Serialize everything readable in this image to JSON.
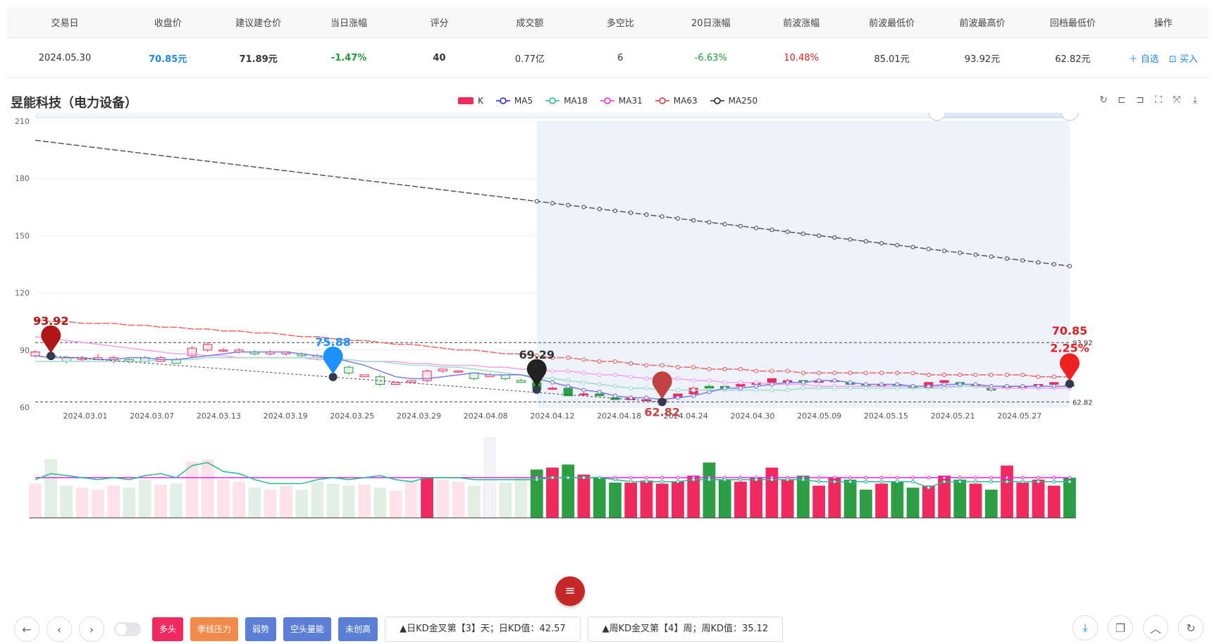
{
  "table": {
    "headers": [
      "交易日",
      "收盘价",
      "建议建仓价",
      "当日涨幅",
      "评分",
      "成交额",
      "多空比",
      "20日涨幅",
      "前波涨幅",
      "前波最低价",
      "前波最高价",
      "回档最低价",
      "操作"
    ],
    "row": {
      "date": "2024.05.30",
      "close": "70.85元",
      "suggest": "71.89元",
      "day_chg": "-1.47%",
      "score": "40",
      "amount": "0.77亿",
      "ratio": "6",
      "chg20": "-6.63%",
      "prev_wave": "10.48%",
      "prev_low": "85.01元",
      "prev_high": "93.92元",
      "pullback_low": "62.82元",
      "op_add": "＋ 自选",
      "op_buy": "买入"
    }
  },
  "chart_title": "昱能科技（电力设备）",
  "legend": [
    {
      "name": "K",
      "color": "#f0295f"
    },
    {
      "name": "MA5",
      "color": "#2222dd"
    },
    {
      "name": "MA18",
      "color": "#1fbf8f"
    },
    {
      "name": "MA31",
      "color": "#ee22ee"
    },
    {
      "name": "MA63",
      "color": "#e03030"
    },
    {
      "name": "MA250",
      "color": "#222222"
    }
  ],
  "chart_data": {
    "type": "candlestick",
    "ylim": [
      60,
      210
    ],
    "yticks": [
      "210",
      "180",
      "150",
      "120",
      "90",
      "60"
    ],
    "xticks": [
      "2024.03.01",
      "2024.03.07",
      "2024.03.13",
      "2024.03.19",
      "2024.03.25",
      "2024.03.29",
      "2024.04.08",
      "2024.04.12",
      "2024.04.18",
      "2024.04.24",
      "2024.04.30",
      "2024.05.09",
      "2024.05.15",
      "2024.05.21",
      "2024.05.27"
    ],
    "candles": [
      [
        87,
        89,
        86,
        90
      ],
      [
        87,
        86,
        85,
        90
      ],
      [
        86,
        84,
        83,
        87
      ],
      [
        85,
        86,
        84,
        87
      ],
      [
        85,
        86,
        85,
        88
      ],
      [
        84,
        86,
        83,
        87
      ],
      [
        85,
        84,
        83,
        86
      ],
      [
        86,
        84,
        83,
        87
      ],
      [
        84,
        86,
        84,
        87
      ],
      [
        85,
        83,
        83,
        86
      ],
      [
        87,
        91,
        86,
        92
      ],
      [
        90,
        93,
        89,
        94
      ],
      [
        90,
        90,
        89,
        91
      ],
      [
        89,
        90,
        88,
        91
      ],
      [
        89,
        88,
        87,
        90
      ],
      [
        88,
        89,
        87,
        90
      ],
      [
        88,
        89,
        87,
        89
      ],
      [
        88,
        87,
        86,
        89
      ],
      [
        87,
        86,
        85,
        88
      ],
      [
        86,
        83,
        82,
        87
      ],
      [
        81,
        78,
        77,
        82
      ],
      [
        76,
        77,
        76,
        77
      ],
      [
        76,
        72,
        71,
        77
      ],
      [
        72,
        73,
        72,
        73
      ],
      [
        73,
        74,
        73,
        74
      ],
      [
        74,
        79,
        73,
        80
      ],
      [
        79,
        80,
        78,
        80
      ],
      [
        79,
        79,
        78,
        79
      ],
      [
        78,
        75,
        74,
        78
      ],
      [
        76,
        77,
        76,
        78
      ],
      [
        77,
        75,
        74,
        77
      ],
      [
        74,
        73,
        73,
        75
      ],
      [
        73,
        70,
        70,
        74
      ],
      [
        70,
        70,
        69,
        71
      ],
      [
        70,
        66,
        66,
        71
      ],
      [
        67,
        67,
        66,
        68
      ],
      [
        67,
        66,
        66,
        67
      ],
      [
        65,
        64,
        64,
        66
      ],
      [
        64,
        65,
        64,
        65
      ],
      [
        64,
        64,
        63,
        65
      ],
      [
        63,
        64,
        62,
        65
      ],
      [
        65,
        67,
        64,
        67
      ],
      [
        67,
        70,
        66,
        71
      ],
      [
        71,
        70,
        69,
        72
      ],
      [
        71,
        70,
        69,
        71
      ],
      [
        71,
        72,
        70,
        72
      ],
      [
        72,
        73,
        71,
        74
      ],
      [
        73,
        75,
        72,
        75
      ],
      [
        73,
        74,
        73,
        75
      ],
      [
        74,
        73,
        72,
        74
      ],
      [
        73,
        74,
        73,
        75
      ],
      [
        74,
        74,
        73,
        75
      ],
      [
        73,
        72,
        71,
        73
      ],
      [
        72,
        71,
        70,
        72
      ],
      [
        71,
        72,
        70,
        72
      ],
      [
        72,
        71,
        70,
        72
      ],
      [
        71,
        70,
        70,
        71
      ],
      [
        70,
        73,
        70,
        73
      ],
      [
        73,
        74,
        72,
        74
      ],
      [
        73,
        72,
        71,
        73
      ],
      [
        71,
        72,
        71,
        72
      ],
      [
        70,
        69,
        68,
        70
      ],
      [
        70,
        71,
        69,
        71
      ],
      [
        70,
        71,
        70,
        71
      ],
      [
        71,
        72,
        70,
        72
      ],
      [
        72,
        73,
        71,
        73
      ],
      [
        72,
        71,
        70,
        72
      ]
    ],
    "ma5": [
      87,
      86,
      86,
      86,
      85,
      85,
      86,
      86,
      85,
      85,
      86,
      87,
      88,
      89,
      89,
      89,
      89,
      88,
      87,
      86,
      84,
      82,
      79,
      76,
      75,
      75,
      76,
      77,
      78,
      77,
      77,
      77,
      75,
      73,
      71,
      69,
      68,
      66,
      65,
      65,
      64,
      65,
      66,
      68,
      70,
      70,
      71,
      72,
      73,
      73,
      74,
      74,
      73,
      72,
      72,
      72,
      71,
      71,
      72,
      72,
      72,
      71,
      71,
      71,
      71,
      71,
      71
    ],
    "ma18": [
      84,
      84,
      84,
      84,
      84,
      84,
      84,
      84,
      85,
      85,
      85,
      86,
      86,
      86,
      86,
      86,
      86,
      86,
      86,
      85,
      85,
      84,
      84,
      83,
      82,
      82,
      81,
      81,
      80,
      79,
      78,
      77,
      76,
      75,
      74,
      73,
      72,
      71,
      70,
      70,
      69,
      69,
      69,
      69,
      69,
      69,
      69,
      69,
      69,
      70,
      70,
      70,
      70,
      70,
      70,
      70,
      70,
      70,
      70,
      71,
      71,
      71,
      71,
      71,
      71,
      71,
      71
    ],
    "ma31": [
      97,
      96,
      95,
      94,
      93,
      92,
      91,
      90,
      89,
      88,
      88,
      87,
      87,
      86,
      86,
      86,
      86,
      86,
      85,
      85,
      85,
      84,
      84,
      84,
      83,
      83,
      82,
      82,
      82,
      81,
      81,
      80,
      80,
      79,
      79,
      78,
      77,
      77,
      76,
      75,
      75,
      75,
      74,
      74,
      73,
      73,
      73,
      72,
      72,
      72,
      71,
      71,
      71,
      71,
      71,
      71,
      71,
      71,
      71,
      71,
      71,
      70,
      70,
      70,
      70,
      70,
      70
    ],
    "ma63": [
      106,
      105,
      105,
      104,
      104,
      104,
      103,
      103,
      102,
      102,
      101,
      101,
      100,
      100,
      99,
      99,
      98,
      97,
      97,
      96,
      95,
      95,
      94,
      93,
      93,
      92,
      91,
      90,
      90,
      89,
      88,
      88,
      87,
      86,
      86,
      85,
      84,
      84,
      83,
      82,
      82,
      81,
      81,
      80,
      80,
      80,
      79,
      79,
      79,
      78,
      78,
      78,
      78,
      78,
      78,
      78,
      78,
      77,
      77,
      77,
      77,
      77,
      77,
      77,
      76,
      76,
      76
    ],
    "ma250": [
      200,
      199,
      198,
      197,
      196,
      195,
      194,
      193,
      192,
      191,
      190,
      189,
      188,
      187,
      186,
      185,
      184,
      183,
      182,
      181,
      180,
      179,
      178,
      177,
      176,
      175,
      174,
      173,
      172,
      171,
      170,
      169,
      168,
      167,
      166,
      165,
      164,
      163,
      162,
      161,
      160,
      159,
      158,
      157,
      156,
      155,
      154,
      153,
      152,
      151,
      150,
      149,
      148,
      147,
      146,
      145,
      144,
      143,
      142,
      141,
      140,
      139,
      138,
      137,
      136,
      135,
      134
    ],
    "volumes": [
      34,
      58,
      32,
      30,
      28,
      32,
      30,
      38,
      33,
      34,
      56,
      58,
      38,
      36,
      30,
      28,
      32,
      28,
      36,
      34,
      32,
      33,
      30,
      27,
      36,
      40,
      38,
      36,
      32,
      32,
      35,
      40,
      48,
      50,
      53,
      43,
      40,
      35,
      35,
      37,
      34,
      36,
      42,
      55,
      38,
      36,
      40,
      50,
      38,
      42,
      32,
      40,
      38,
      28,
      34,
      36,
      30,
      32,
      42,
      38,
      34,
      28,
      52,
      35,
      38,
      32,
      40
    ],
    "vol_ma_green": [
      38,
      44,
      42,
      40,
      38,
      40,
      38,
      42,
      44,
      40,
      52,
      55,
      46,
      44,
      38,
      34,
      34,
      34,
      38,
      40,
      38,
      40,
      42,
      38,
      36,
      40,
      40,
      40,
      38,
      38,
      38,
      38,
      38,
      40,
      40,
      40,
      40,
      38,
      36,
      36,
      36,
      36,
      38,
      38,
      38,
      38,
      38,
      38,
      38,
      38,
      36,
      36,
      36,
      36,
      36,
      36,
      36,
      30,
      36,
      36,
      36,
      36,
      36,
      36,
      36,
      36,
      36
    ],
    "vol_ma_pink": [
      40,
      40,
      40,
      40,
      40,
      40,
      40,
      40,
      40,
      40,
      40,
      40,
      40,
      40,
      40,
      40,
      40,
      40,
      40,
      40,
      40,
      40,
      40,
      40,
      40,
      40,
      40,
      40,
      40,
      40,
      40,
      40,
      40,
      40,
      40,
      40,
      40,
      40,
      40,
      40,
      40,
      40,
      40,
      40,
      40,
      40,
      40,
      40,
      40,
      40,
      40,
      40,
      40,
      40,
      40,
      40,
      40,
      40,
      40,
      40,
      40,
      40,
      40,
      40,
      40,
      40,
      40
    ],
    "annotations": {
      "high": {
        "label": "93.92",
        "value": 93.92
      },
      "low": {
        "label": "62.82",
        "value": 62.82
      },
      "blue": {
        "label": "75.88",
        "value": 75.88
      },
      "black": {
        "label": "69.29",
        "value": 69.29
      },
      "last": {
        "label": "70.85",
        "value": 70.85
      },
      "pct": {
        "label": "2.25%"
      },
      "hline_high": "93.92",
      "hline_low": "62.82"
    }
  },
  "bottom_bar": {
    "tags": [
      {
        "label": "多头",
        "color": "#f0295f"
      },
      {
        "label": "季线压力",
        "color": "#f28a4b"
      },
      {
        "label": "弱势",
        "color": "#5b7fd6"
      },
      {
        "label": "空头量能",
        "color": "#5b7fd6"
      },
      {
        "label": "未创高",
        "color": "#5b7fd6"
      }
    ],
    "kd_day": "▲日KD金叉第【3】天；日KD值：42.57",
    "kd_week": "▲周KD金叉第【4】周；周KD值：35.12"
  }
}
